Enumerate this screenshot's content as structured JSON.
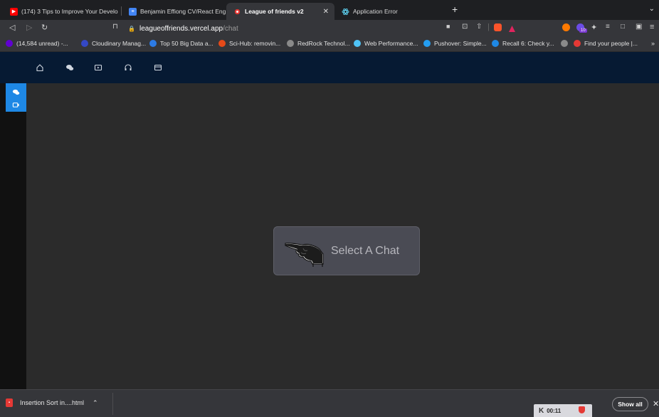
{
  "browser": {
    "tabs": [
      {
        "title": "(174) 3 Tips to Improve Your Develo",
        "icon": "youtube-icon",
        "color": "#ff0000"
      },
      {
        "title": "Benjamin Effiong CV/React Enginee",
        "icon": "google-docs-icon",
        "color": "#4285f4"
      },
      {
        "title": "League of friends v2",
        "icon": "react-icon",
        "color": "#e53935",
        "active": true
      },
      {
        "title": "Application Error",
        "icon": "react-icon",
        "color": "#61dafb"
      }
    ],
    "new_tab": "+",
    "address": {
      "host": "leagueoffriends.vercel.app",
      "path": "/chat"
    },
    "bookmarks": [
      {
        "label": "(14,584 unread) -...",
        "color": "#6001d2"
      },
      {
        "label": "Cloudinary Manag...",
        "color": "#3448c5"
      },
      {
        "label": "Top 50 Big Data a...",
        "color": "#2c7be5"
      },
      {
        "label": "Sci-Hub: removin...",
        "color": "#e64a19"
      },
      {
        "label": "RedRock Technol...",
        "color": "#8a8a8a"
      },
      {
        "label": "Web Performance...",
        "color": "#4fc3f7"
      },
      {
        "label": "Pushover: Simple...",
        "color": "#249df1"
      },
      {
        "label": "Recall 6: Check y...",
        "color": "#1e88e5"
      },
      {
        "label": "Find your people |...",
        "color": "#e53935"
      }
    ],
    "bookmarks_more": "»",
    "extension_badge": "10"
  },
  "app": {
    "nav_icons": [
      "home-icon",
      "chat-icon",
      "video-icon",
      "headphones-icon",
      "card-icon"
    ],
    "sidebar_icons": [
      "chat-icon",
      "video-icon"
    ],
    "empty_state": {
      "label": "Select A Chat",
      "icon": "pointing-hand-icon"
    },
    "colors": {
      "nav": "#061a33",
      "accent": "#1e88e5",
      "content": "#2b2b2b"
    }
  },
  "downloads": {
    "item": "Insertion Sort in....html",
    "show_all": "Show all",
    "timer": "00:11"
  }
}
